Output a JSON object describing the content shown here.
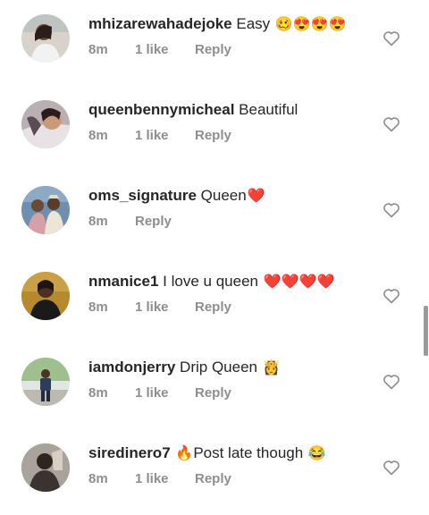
{
  "comments": [
    {
      "username": "mhizarewahadejoke",
      "text": "Easy",
      "emoji": "🥴😍😍😍",
      "time": "8m",
      "likes": "1 like",
      "reply": "Reply",
      "avatar": "avatar-woman-icon"
    },
    {
      "username": "queenbennymicheal",
      "text": "Beautiful",
      "emoji": "",
      "time": "8m",
      "likes": "1 like",
      "reply": "Reply",
      "avatar": "avatar-woman-icon"
    },
    {
      "username": "oms_signature",
      "text": "Queen",
      "emoji": "❤️",
      "time": "8m",
      "likes": "",
      "reply": "Reply",
      "avatar": "avatar-couple-icon"
    },
    {
      "username": "nmanice1",
      "text": "I love u queen",
      "emoji": "❤️❤️❤️❤️",
      "time": "8m",
      "likes": "1 like",
      "reply": "Reply",
      "avatar": "avatar-woman-icon"
    },
    {
      "username": "iamdonjerry",
      "text": "Drip Queen",
      "emoji": "👸",
      "time": "8m",
      "likes": "1 like",
      "reply": "Reply",
      "avatar": "avatar-man-icon"
    },
    {
      "username": "siredinero7",
      "text": "Post late though",
      "emoji": "😂",
      "prefix_emoji": "🔥",
      "time": "8m",
      "likes": "1 like",
      "reply": "Reply",
      "avatar": "avatar-man-icon"
    }
  ],
  "colors": {
    "text": "#262626",
    "meta": "#8e8e8e",
    "heart_outline": "#8e8e8e"
  }
}
